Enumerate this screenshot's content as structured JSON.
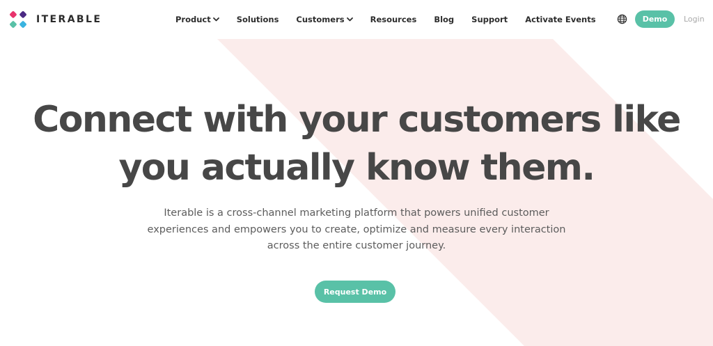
{
  "brand": {
    "name": "ITERABLE",
    "colors": {
      "accent": "#59c1a7",
      "band": "#fbeceb",
      "headline": "#474747",
      "body_text": "#5c5c5c",
      "logo_purple": "#4b2a83",
      "logo_pink": "#e8336c",
      "logo_teal": "#59c1a7",
      "logo_cyan": "#3ab4e0"
    }
  },
  "header": {
    "nav": [
      {
        "label": "Product",
        "has_dropdown": true
      },
      {
        "label": "Solutions",
        "has_dropdown": false
      },
      {
        "label": "Customers",
        "has_dropdown": true
      },
      {
        "label": "Resources",
        "has_dropdown": false
      },
      {
        "label": "Blog",
        "has_dropdown": false
      },
      {
        "label": "Support",
        "has_dropdown": false
      },
      {
        "label": "Activate Events",
        "has_dropdown": false
      }
    ],
    "language_icon": "globe-icon",
    "demo_label": "Demo",
    "login_label": "Login"
  },
  "hero": {
    "headline_line1": "Connect with your customers like",
    "headline_line2": "you actually know them.",
    "subtext_line1": "Iterable is a cross-channel marketing platform that powers unified customer",
    "subtext_line2": "experiences and empowers you to create, optimize and measure every interaction",
    "subtext_line3": "across the entire customer journey.",
    "cta_label": "Request Demo"
  }
}
